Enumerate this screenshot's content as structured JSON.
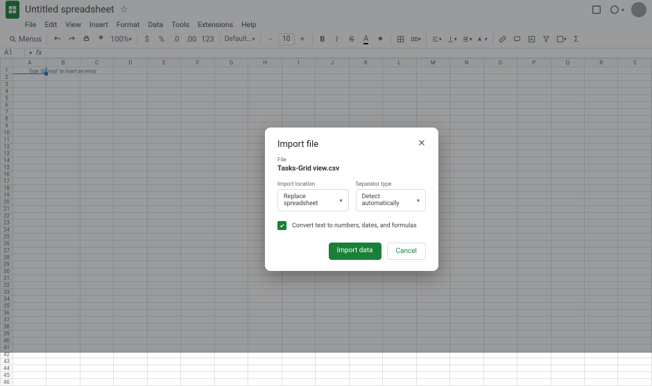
{
  "header": {
    "title": "Untitled spreadsheet"
  },
  "menubar": [
    "File",
    "Edit",
    "View",
    "Insert",
    "Format",
    "Data",
    "Tools",
    "Extensions",
    "Help"
  ],
  "toolbar": {
    "menus_label": "Menus",
    "zoom": "100%",
    "font_name": "Default...",
    "font_size": "10"
  },
  "namebox": {
    "cell": "A1"
  },
  "grid": {
    "columns": [
      "A",
      "B",
      "C",
      "D",
      "E",
      "F",
      "G",
      "H",
      "I",
      "J",
      "K",
      "L",
      "M",
      "N",
      "O",
      "P",
      "Q",
      "R",
      "S"
    ],
    "rows": 46,
    "cell_hint": "Type \"@Emoji\" to insert an emoji"
  },
  "dialog": {
    "title": "Import file",
    "file_label": "File",
    "file_name": "Tasks-Grid view.csv",
    "import_location_label": "Import location",
    "import_location_value": "Replace spreadsheet",
    "separator_label": "Separator type",
    "separator_value": "Detect automatically",
    "convert_label": "Convert text to numbers, dates, and formulas",
    "import_button": "Import data",
    "cancel_button": "Cancel"
  }
}
